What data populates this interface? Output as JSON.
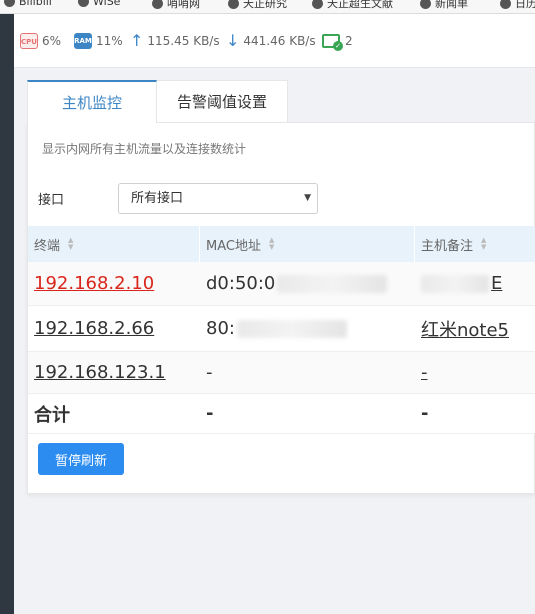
{
  "bookmarks": [
    "Bilibili",
    "WiSe",
    "哨哨网",
    "天正研究",
    "天正超生文献",
    "新闻单",
    "日历"
  ],
  "stats": {
    "cpu_badge": "CPU",
    "cpu": "6%",
    "ram_badge": "RAM",
    "ram": "11%",
    "upload": "115.45 KB/s",
    "download": "441.46 KB/s",
    "devices": "2"
  },
  "tabs": [
    {
      "label": "主机监控",
      "active": true
    },
    {
      "label": "告警阈值设置",
      "active": false
    }
  ],
  "panel": {
    "description": "显示内网所有主机流量以及连接数统计",
    "interface_label": "接口",
    "interface_selected": "所有接口"
  },
  "table": {
    "headers": [
      "终端",
      "MAC地址",
      "主机备注"
    ],
    "rows": [
      {
        "terminal": "192.168.2.10",
        "mac": "d0:50:0",
        "note": "E",
        "highlight": true
      },
      {
        "terminal": "192.168.2.66",
        "mac": "80:",
        "note": "红米note5",
        "highlight": false
      },
      {
        "terminal": "192.168.123.1",
        "mac": "-",
        "note": "-",
        "highlight": false
      }
    ],
    "total": {
      "label": "合计",
      "mac": "-",
      "note": "-"
    }
  },
  "pause_button": "暂停刷新",
  "colors": {
    "accent": "#3d86c6",
    "button": "#2d8cf0",
    "alert": "#d9261c",
    "header_bg": "#e8f2fb"
  }
}
